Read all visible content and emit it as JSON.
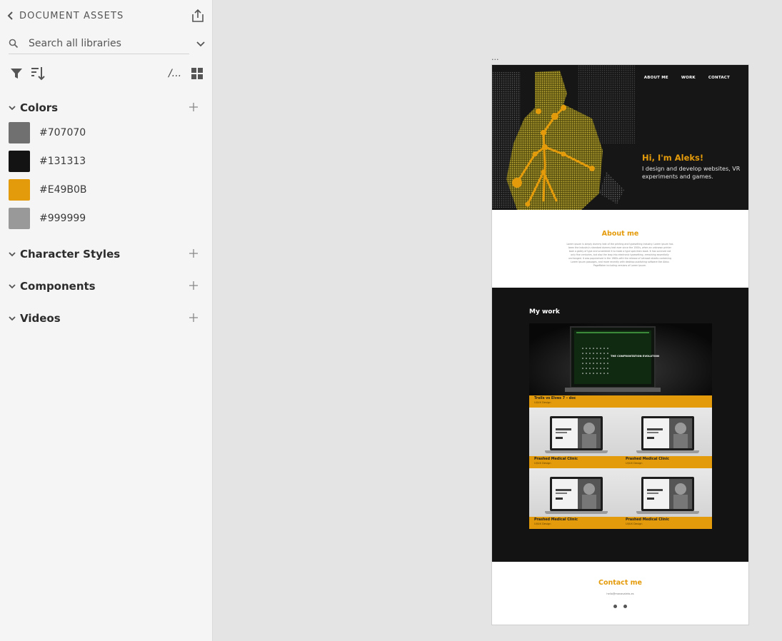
{
  "panel": {
    "title": "DOCUMENT ASSETS",
    "search_placeholder": "Search all libraries",
    "path_label": "/...",
    "sections": {
      "colors": "Colors",
      "character_styles": "Character Styles",
      "components": "Components",
      "videos": "Videos"
    },
    "colors": [
      {
        "hex": "#707070"
      },
      {
        "hex": "#131313"
      },
      {
        "hex": "#E49B0B"
      },
      {
        "hex": "#999999"
      }
    ]
  },
  "artboard": {
    "menu_dots": "...",
    "nav": [
      "ABOUT ME",
      "WORK",
      "CONTACT"
    ],
    "hero": {
      "title": "Hi, I'm Aleks!",
      "subtitle": "I design and develop websites, VR experiments and games."
    },
    "about": {
      "title": "About me",
      "body": "Lorem ipsum is simply dummy text of the printing and typesetting industry. Lorem ipsum has been the industry's standard dummy text ever since the 1500s, when an unknown printer took a galley of type and scrambled it to make a type specimen book. It has survived not only five centuries, but also the leap into electronic typesetting, remaining essentially unchanged. It was popularised in the 1960s with the release of Letraset sheets containing Lorem Ipsum passages, and more recently with desktop publishing software like Aldus PageMaker including versions of Lorem Ipsum."
    },
    "work": {
      "title": "My work",
      "featured": {
        "title": "Trolls vs Elves 7 – doc",
        "subtitle": "UI/UX Design",
        "screen_text": "THE CONFRONTATION EVOLUTION"
      },
      "cards": [
        {
          "title": "Prashed Medical Clinic",
          "subtitle": "UI/UX Design"
        },
        {
          "title": "Prashed Medical Clinic",
          "subtitle": "UI/UX Design"
        },
        {
          "title": "Prashed Medical Clinic",
          "subtitle": "UI/UX Design"
        },
        {
          "title": "Prashed Medical Clinic",
          "subtitle": "UI/UX Design"
        }
      ]
    },
    "contact": {
      "title": "Contact me",
      "email": "hello@manavaleks.es"
    }
  },
  "accent_color": "#E49B0B"
}
